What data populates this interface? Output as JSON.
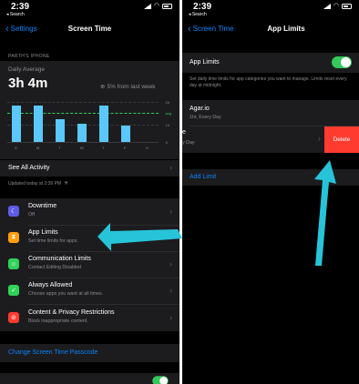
{
  "left_screen": {
    "status": {
      "time": "2:39",
      "back_app": "◂ Search"
    },
    "nav": {
      "back_label": "Settings",
      "title": "Screen Time"
    },
    "device_name": "PARTH'S IPHONE",
    "summary": {
      "label": "Daily Average",
      "value": "3h 4m",
      "change": "5% from last week",
      "grid_labels": [
        "avg",
        "2h",
        "1h",
        "0"
      ],
      "days": [
        "S",
        "M",
        "T",
        "W",
        "T",
        "F",
        "S"
      ],
      "bar_levels": [
        0.92,
        0.9,
        0.56,
        0.45,
        0.92,
        0.42,
        0
      ]
    },
    "see_all": "See All Activity",
    "updated": "Updated today at 2:39 PM",
    "items": [
      {
        "title": "Downtime",
        "subtitle": "Off",
        "icon": "moon-icon",
        "color": "#5e5ce6"
      },
      {
        "title": "App Limits",
        "subtitle": "Set time limits for apps.",
        "icon": "hourglass-icon",
        "color": "#ff9f0a"
      },
      {
        "title": "Communication Limits",
        "subtitle": "Contact Editing Disabled",
        "icon": "person-bubble-icon",
        "color": "#30d158"
      },
      {
        "title": "Always Allowed",
        "subtitle": "Choose apps you want at all times.",
        "icon": "checkmark-icon",
        "color": "#30d158"
      },
      {
        "title": "Content & Privacy Restrictions",
        "subtitle": "Block inappropriate content.",
        "icon": "no-entry-icon",
        "color": "#ff3b30"
      }
    ],
    "passcode_link": "Change Screen Time Passcode"
  },
  "right_screen": {
    "status": {
      "time": "2:39",
      "back_app": "◂ Search"
    },
    "nav": {
      "back_label": "Screen Time",
      "title": "App Limits"
    },
    "toggle": {
      "label": "App Limits",
      "on": true
    },
    "description": "Set daily time limits for app categories you want to manage. Limits reset every day at midnight.",
    "limits": [
      {
        "name": "Agar.io",
        "detail": "1hr, Every Day"
      },
      {
        "name": "e",
        "detail": "y Day"
      }
    ],
    "delete_label": "Delete",
    "add_limit": "Add Limit"
  },
  "colors": {
    "accent": "#0a84ff",
    "arrow": "#27c4d9",
    "delete": "#ff3b30",
    "bars": "#5ac8fa"
  }
}
